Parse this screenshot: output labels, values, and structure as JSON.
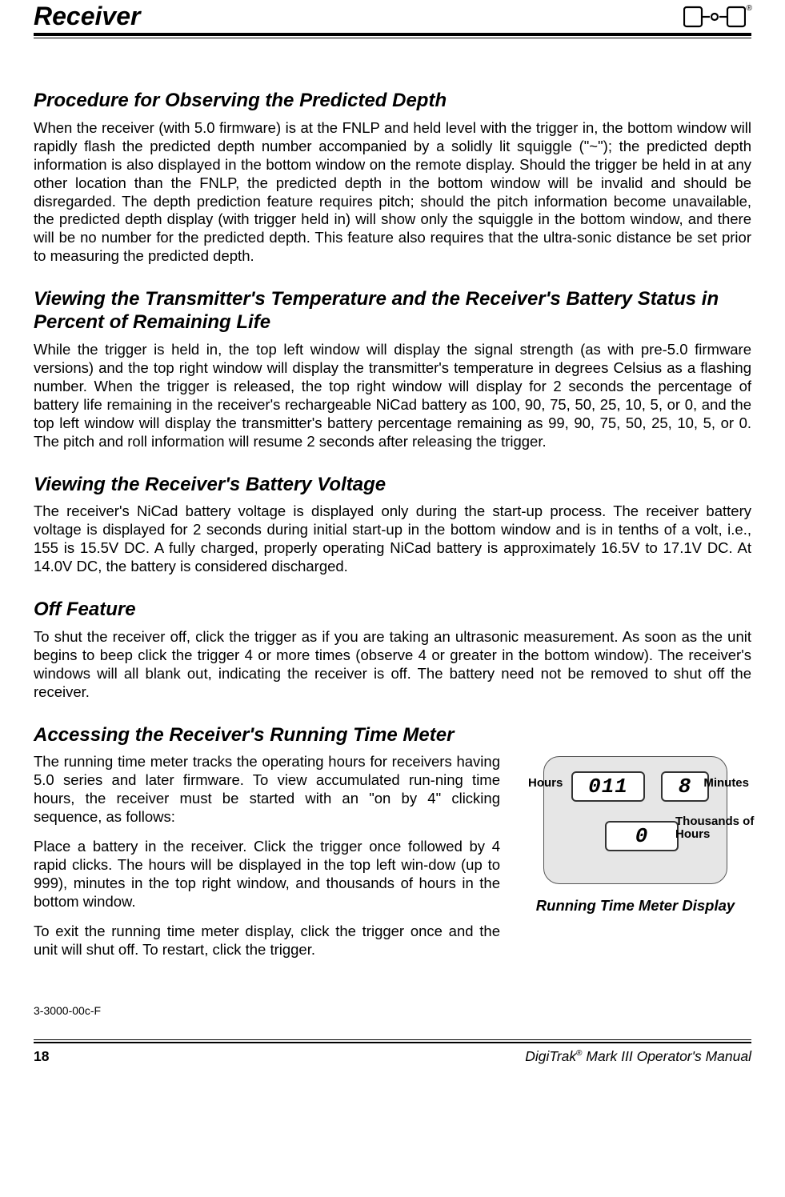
{
  "header": {
    "title": "Receiver",
    "logo_reg": "®"
  },
  "sections": {
    "s1": {
      "heading": "Procedure for Observing the Predicted Depth",
      "p1": "When the receiver (with 5.0 firmware) is at the FNLP and held level with the trigger in, the bottom window will rapidly flash the predicted depth number accompanied by a solidly lit squiggle (\"~\"); the predicted depth information is also displayed in the bottom window on the remote display.  Should the trigger be held in at any other location than the FNLP, the predicted depth in the bottom window will be invalid and should be disregarded.  The depth prediction feature requires pitch; should the pitch information become unavailable, the predicted depth display (with trigger held in) will show only the squiggle in the bottom window, and there will be no number for the predicted depth.  This feature also requires that the ultra-sonic distance be set prior to measuring the predicted depth."
    },
    "s2": {
      "heading": "Viewing the Transmitter's Temperature and the Receiver's Battery Status in Percent of Remaining Life",
      "p1": "While the trigger is held in, the top left window will display the signal strength (as with pre-5.0 firmware versions) and the top right window will display the transmitter's temperature in degrees Celsius as a flashing number.  When the trigger is released, the top right window will display for 2 seconds the percentage of battery life remaining in the receiver's rechargeable NiCad battery as 100, 90, 75, 50, 25, 10, 5, or 0, and the top left window will display the transmitter's battery percentage remaining as 99, 90, 75, 50, 25, 10, 5, or 0.  The pitch and roll information will resume 2 seconds after releasing the trigger."
    },
    "s3": {
      "heading": "Viewing the Receiver's Battery Voltage",
      "p1": "The receiver's NiCad battery voltage is displayed only during the start-up process.  The receiver battery voltage is displayed for 2 seconds during initial start-up in the bottom window and is in tenths of a volt, i.e., 155 is 15.5V DC.  A fully charged, properly operating NiCad battery is approximately 16.5V to 17.1V DC.  At 14.0V DC, the battery is considered discharged."
    },
    "s4": {
      "heading": "Off Feature",
      "p1": "To shut the receiver off, click the trigger as if you are taking an ultrasonic measurement.  As soon as the unit begins to beep click the trigger 4 or more times (observe 4 or greater in the bottom window).  The receiver's windows will all blank out, indicating the receiver is off.  The battery need not be removed to shut off the receiver."
    },
    "s5": {
      "heading": "Accessing the Receiver's Running Time Meter",
      "p1": "The running time meter tracks the operating hours for receivers having 5.0 series and later firmware.  To view accumulated run-ning time hours, the receiver must be started with an \"on by 4\" clicking sequence, as follows:",
      "p2": "Place a battery in the receiver.  Click the trigger once followed by 4 rapid clicks.  The hours will be displayed in the top left win-dow (up to 999), minutes in the top right window, and thousands of hours in the bottom window.",
      "p3": "To exit the running time meter display, click the trigger once and the unit will shut off.  To restart, click the trigger."
    }
  },
  "figure": {
    "lcd_hours": "011",
    "lcd_minutes": "8",
    "lcd_thousands": "0",
    "label_hours": "Hours",
    "label_minutes": "Minutes",
    "label_thousands": "Thousands of Hours",
    "caption": "Running Time Meter Display"
  },
  "revision": "3-3000-00c-F",
  "footer": {
    "page": "18",
    "manual_prefix": "DigiTrak",
    "reg": "®",
    "manual_suffix": " Mark III Operator's Manual"
  }
}
